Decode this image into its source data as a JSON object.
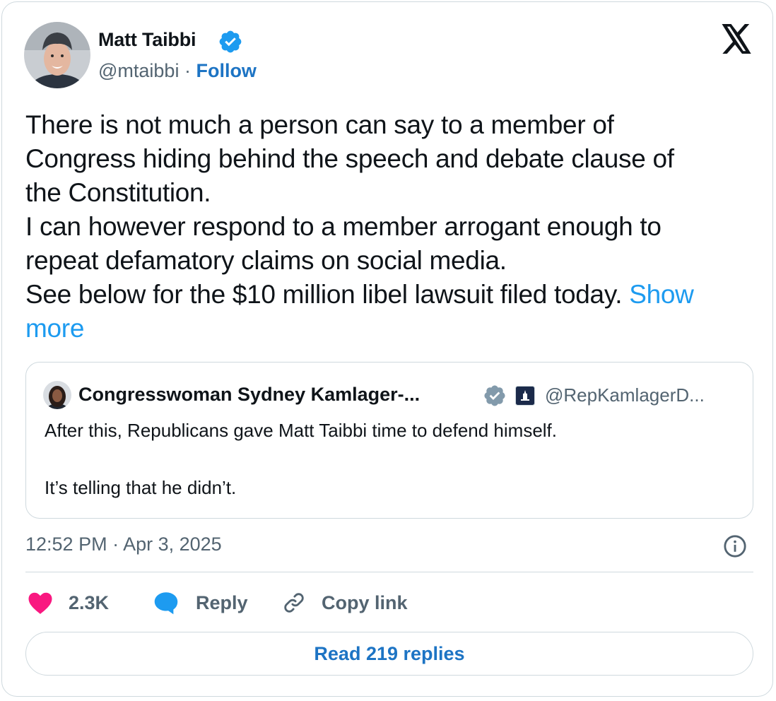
{
  "author": {
    "name": "Matt Taibbi",
    "handle": "@mtaibbi",
    "separator": " · ",
    "follow_label": "Follow"
  },
  "tweet": {
    "lines": [
      "There is not much a person can say to a member of",
      "Congress hiding behind the speech and debate clause of",
      "the Constitution.",
      "I can however respond to a member arrogant enough to",
      "repeat defamatory claims on social media.",
      "See below for the $10 million libel lawsuit filed today. "
    ],
    "show_more_part1": "Show",
    "show_more_part2": "more"
  },
  "quote": {
    "name": "Congresswoman Sydney Kamlager-...",
    "handle": "@RepKamlagerD...",
    "paragraph1": "After this, Republicans gave Matt Taibbi time to defend himself.",
    "paragraph2": "It’s telling that he didn’t."
  },
  "timestamp": "12:52 PM · Apr 3, 2025",
  "actions": {
    "like_count": "2.3K",
    "reply_label": "Reply",
    "copy_label": "Copy link"
  },
  "read_replies_label": "Read 219 replies",
  "colors": {
    "accent": "#1d9bf0",
    "follow": "#1d74c4",
    "like": "#f91880",
    "secondary_text": "#536471",
    "border": "#cfd9de",
    "verified_blue": "#1d9bf0",
    "verified_gray": "#829aab"
  },
  "icons": [
    "verified-badge-icon",
    "x-logo-icon",
    "government-badge-icon",
    "info-icon",
    "heart-icon",
    "reply-bubble-icon",
    "link-icon"
  ]
}
